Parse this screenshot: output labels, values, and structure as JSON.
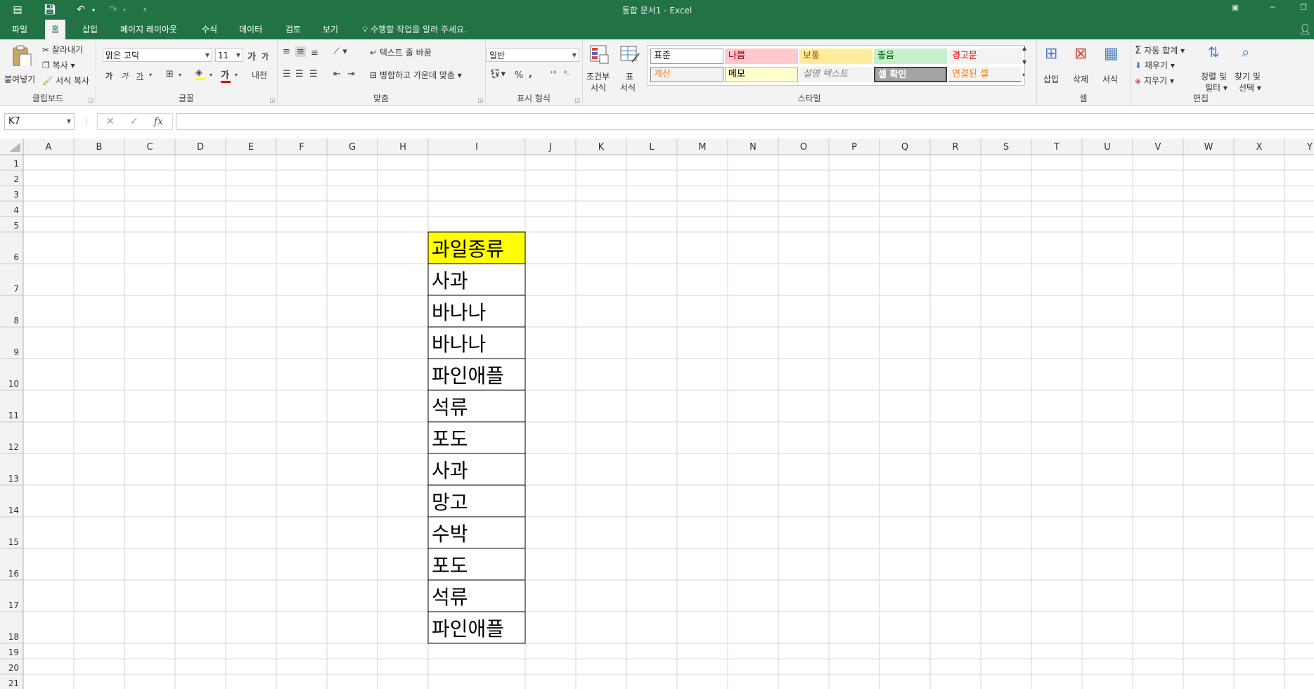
{
  "titlebar": {
    "title": "통합 문서1 - Excel",
    "quick_access": [
      "excel-icon",
      "save-icon",
      "undo-icon",
      "redo-icon",
      "customize-icon"
    ]
  },
  "tabs": [
    {
      "label": "파일",
      "active": false
    },
    {
      "label": "홈",
      "active": true
    },
    {
      "label": "삽입",
      "active": false
    },
    {
      "label": "페이지 레이아웃",
      "active": false
    },
    {
      "label": "수식",
      "active": false
    },
    {
      "label": "데이터",
      "active": false
    },
    {
      "label": "검토",
      "active": false
    },
    {
      "label": "보기",
      "active": false
    }
  ],
  "tell_me": "수행할 작업을 알려 주세요.",
  "ribbon": {
    "clipboard": {
      "paste": "붙여넣기",
      "cut": "잘라내기",
      "copy": "복사",
      "format_painter": "서식 복사",
      "label": "클립보드"
    },
    "font": {
      "name": "맑은 고딕",
      "size": "11",
      "bold": "가",
      "italic": "가",
      "underline": "가",
      "label": "글꼴",
      "grow": "가",
      "shrink": "가",
      "phonetic": "내천"
    },
    "alignment": {
      "wrap": "텍스트 줄 바꿈",
      "merge": "병합하고 가운데 맞춤",
      "label": "맞춤"
    },
    "number": {
      "format": "일반",
      "percent": "%",
      "comma": ",",
      "label": "표시 형식"
    },
    "styles": {
      "conditional": "조건부 서식",
      "cond_line1": "조건부",
      "cond_line2": "서식",
      "table_line1": "표",
      "table_line2": "서식",
      "label": "스타일",
      "cells_row1": [
        {
          "text": "표준",
          "bg": "#ffffff",
          "fg": "#000000",
          "border": "#9a9a9a"
        },
        {
          "text": "나쁨",
          "bg": "#ffc7ce",
          "fg": "#9c0006",
          "border": "#ffc7ce"
        },
        {
          "text": "보통",
          "bg": "#ffeb9c",
          "fg": "#9c5700",
          "border": "#ffeb9c"
        },
        {
          "text": "좋음",
          "bg": "#c6efce",
          "fg": "#006100",
          "border": "#c6efce"
        },
        {
          "text": "경고문",
          "bg": "#f3f3f3",
          "fg": "#ff0000",
          "border": "#f3f3f3"
        }
      ],
      "cells_row2": [
        {
          "text": "계산",
          "bg": "#f2f2f2",
          "fg": "#fa7d00",
          "border": "#7f7f7f"
        },
        {
          "text": "메모",
          "bg": "#ffffcc",
          "fg": "#000000",
          "border": "#b2b2b2"
        },
        {
          "text": "설명 텍스트",
          "bg": "#f3f3f3",
          "fg": "#7f7f7f",
          "border": "#f3f3f3"
        },
        {
          "text": "셀 확인",
          "bg": "#a5a5a5",
          "fg": "#ffffff",
          "border": "#3f3f3f"
        },
        {
          "text": "연결된 셀",
          "bg": "#f3f3f3",
          "fg": "#fa7d00",
          "border": "#f3f3f3"
        }
      ]
    },
    "cells": {
      "insert": "삽입",
      "delete": "삭제",
      "format": "서식",
      "label": "셀"
    },
    "editing": {
      "autosum": "자동 합계",
      "fill": "채우기",
      "clear": "지우기",
      "sort_l1": "정렬 및",
      "sort_l2": "필터",
      "find_l1": "찾기 및",
      "find_l2": "선택",
      "label": "편집"
    }
  },
  "formula_bar": {
    "name_box": "K7",
    "cancel": "✕",
    "enter": "✓",
    "fx": "fx",
    "value": ""
  },
  "sheet": {
    "columns": [
      "A",
      "B",
      "C",
      "D",
      "E",
      "F",
      "G",
      "H",
      "I",
      "J",
      "K",
      "L",
      "M",
      "N",
      "O",
      "P",
      "Q",
      "R",
      "S",
      "T",
      "U",
      "V",
      "W",
      "X",
      "Y"
    ],
    "rows": [
      "1",
      "2",
      "3",
      "4",
      "5",
      "6",
      "7",
      "8",
      "9",
      "10",
      "11",
      "12",
      "13",
      "14",
      "15",
      "16",
      "17",
      "18",
      "19",
      "20",
      "21"
    ],
    "data_column": "I",
    "header_fill": "#ffff00",
    "cells": [
      {
        "row": "6",
        "value": "과일종류",
        "header": true
      },
      {
        "row": "7",
        "value": "사과"
      },
      {
        "row": "8",
        "value": "바나나"
      },
      {
        "row": "9",
        "value": "바나나"
      },
      {
        "row": "10",
        "value": "파인애플"
      },
      {
        "row": "11",
        "value": "석류"
      },
      {
        "row": "12",
        "value": "포도"
      },
      {
        "row": "13",
        "value": "사과"
      },
      {
        "row": "14",
        "value": "망고"
      },
      {
        "row": "15",
        "value": "수박"
      },
      {
        "row": "16",
        "value": "포도"
      },
      {
        "row": "17",
        "value": "석류"
      },
      {
        "row": "18",
        "value": "파인애플"
      }
    ]
  }
}
